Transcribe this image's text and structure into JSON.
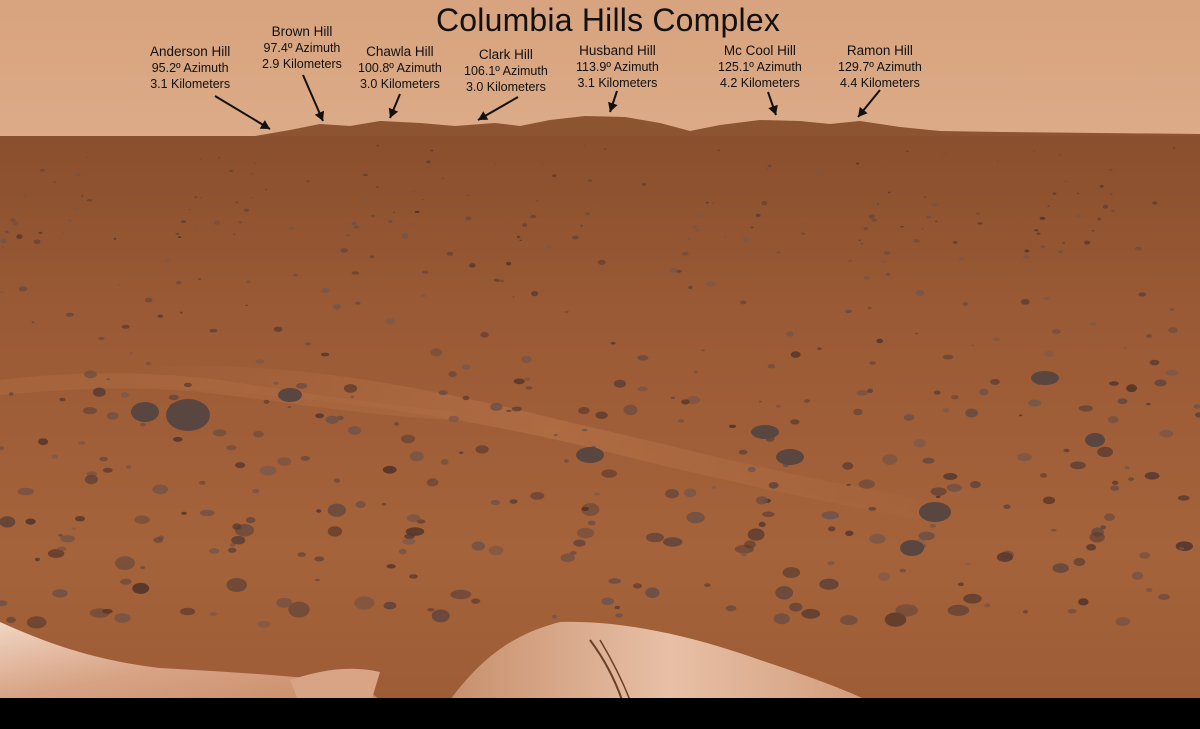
{
  "title": "Columbia Hills Complex",
  "colors": {
    "sky": "#d7a27e",
    "ground": "#9a5a34",
    "hills": "#8f5532",
    "label_text": "#111111",
    "arrow": "#111111"
  },
  "hills": [
    {
      "name": "Anderson Hill",
      "azimuth": "95.2º Azimuth",
      "distance": "3.1 Kilometers",
      "arrow_icon": "arrow-down-right-icon"
    },
    {
      "name": "Brown Hill",
      "azimuth": "97.4º Azimuth",
      "distance": "2.9 Kilometers",
      "arrow_icon": "arrow-down-right-icon"
    },
    {
      "name": "Chawla Hill",
      "azimuth": "100.8º Azimuth",
      "distance": "3.0 Kilometers",
      "arrow_icon": "arrow-down-left-icon"
    },
    {
      "name": "Clark Hill",
      "azimuth": "106.1º Azimuth",
      "distance": "3.0 Kilometers",
      "arrow_icon": "arrow-down-left-icon"
    },
    {
      "name": "Husband Hill",
      "azimuth": "113.9º Azimuth",
      "distance": "3.1 Kilometers",
      "arrow_icon": "arrow-down-icon"
    },
    {
      "name": "Mc Cool Hill",
      "azimuth": "125.1º Azimuth",
      "distance": "4.2 Kilometers",
      "arrow_icon": "arrow-down-icon"
    },
    {
      "name": "Ramon Hill",
      "azimuth": "129.7º Azimuth",
      "distance": "4.4 Kilometers",
      "arrow_icon": "arrow-down-left-icon"
    }
  ]
}
